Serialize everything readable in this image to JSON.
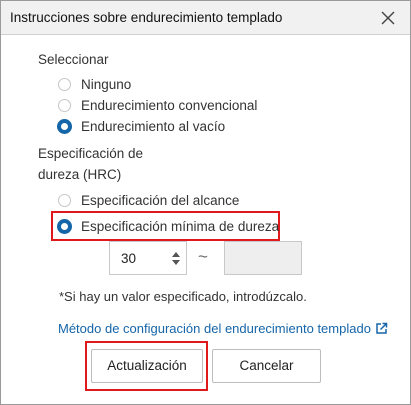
{
  "dialog": {
    "title": "Instrucciones sobre endurecimiento templado",
    "close_icon": "close-icon"
  },
  "seleccionar": {
    "label": "Seleccionar",
    "options": [
      {
        "label": "Ninguno",
        "selected": false
      },
      {
        "label": "Endurecimiento convencional",
        "selected": false
      },
      {
        "label": "Endurecimiento al vacío",
        "selected": true
      }
    ]
  },
  "hardness": {
    "label_line1": "Especificación de",
    "label_line2": "dureza (HRC)",
    "options": [
      {
        "label": "Especificación del alcance",
        "selected": false
      },
      {
        "label": "Especificación mínima de dureza",
        "selected": true
      }
    ],
    "min_value": "30",
    "separator": "~",
    "max_value": ""
  },
  "note": "*Si hay un valor especificado, introdúzcalo.",
  "link": {
    "text": "Método de configuración del endurecimiento templado",
    "icon": "external-link-icon"
  },
  "buttons": {
    "update": "Actualización",
    "cancel": "Cancelar"
  },
  "colors": {
    "accent": "#1466a8",
    "highlight": "#e0191c",
    "link": "#1565a8"
  }
}
